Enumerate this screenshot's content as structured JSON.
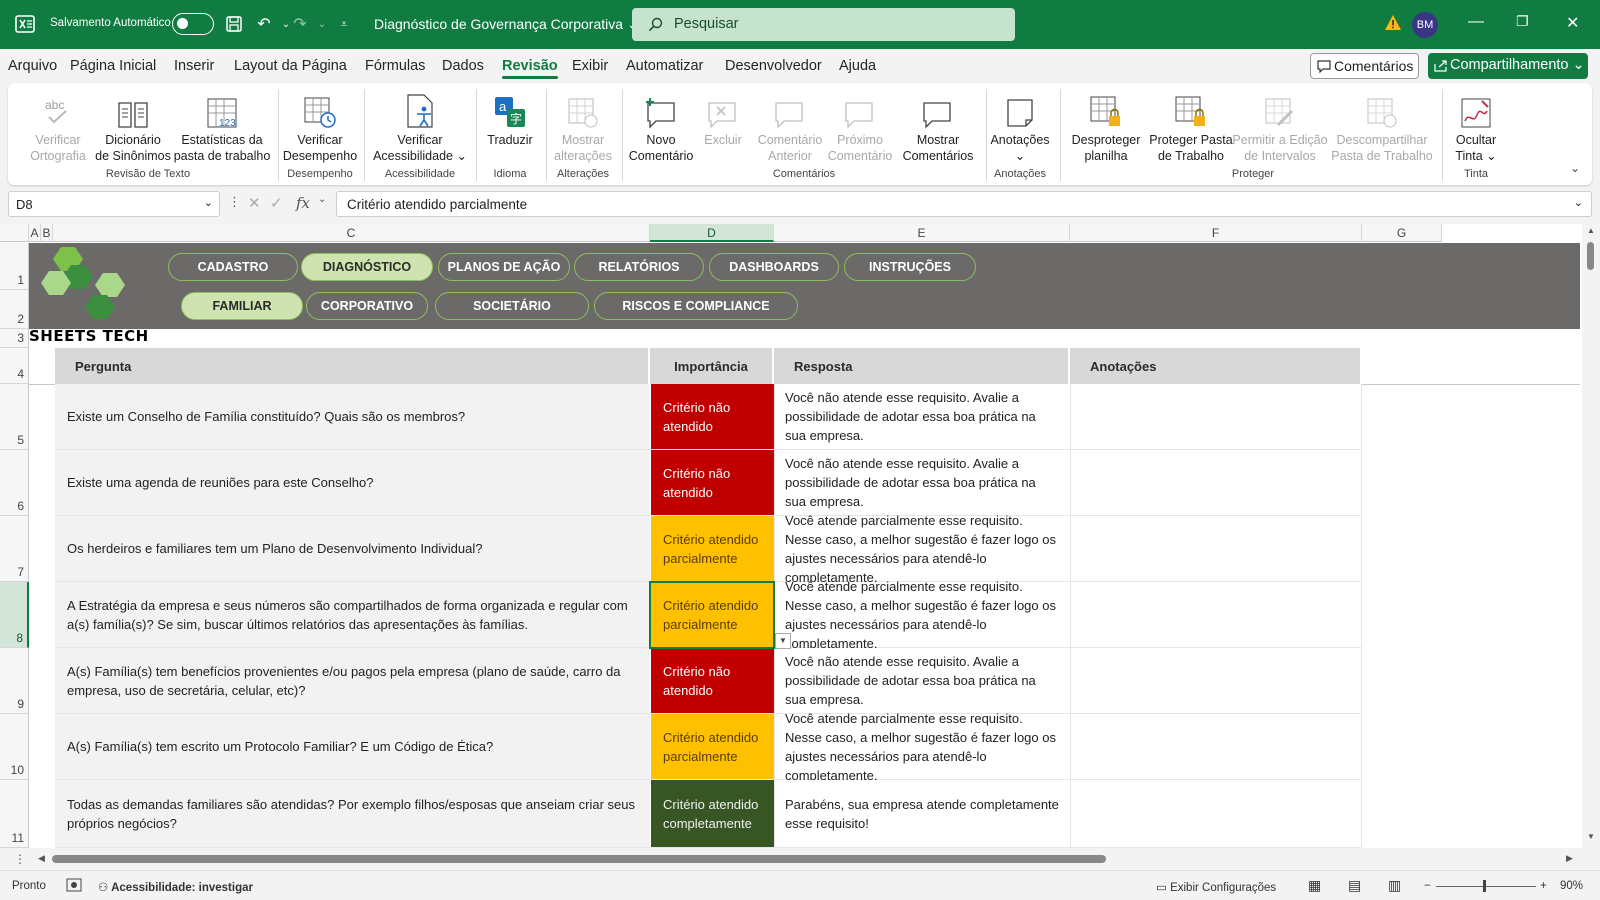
{
  "app": {
    "autosave_label": "Salvamento Automático",
    "doc_title": "Diagnóstico de Governança Corporativa",
    "search_placeholder": "Pesquisar",
    "avatar_initials": "BM",
    "accent": "#107c41"
  },
  "menu": {
    "tabs": [
      "Arquivo",
      "Página Inicial",
      "Inserir",
      "Layout da Página",
      "Fórmulas",
      "Dados",
      "Revisão",
      "Exibir",
      "Automatizar",
      "Desenvolvedor",
      "Ajuda"
    ],
    "active": "Revisão",
    "comments_btn": "Comentários",
    "share_btn": "Compartilhamento"
  },
  "ribbon": {
    "buttons": [
      {
        "l1": "Verificar",
        "l2": "Ortografia",
        "disabled": true,
        "icon": "abc-check-icon"
      },
      {
        "l1": "Dicionário",
        "l2": "de Sinônimos",
        "disabled": false,
        "icon": "thesaurus-book-icon"
      },
      {
        "l1": "Estatísticas da",
        "l2": "pasta de trabalho",
        "disabled": false,
        "icon": "workbook-statistics-icon"
      },
      {
        "l1": "Verificar",
        "l2": "Desempenho",
        "disabled": false,
        "icon": "performance-check-icon"
      },
      {
        "l1": "Verificar",
        "l2": "Acessibilidade ⌄",
        "disabled": false,
        "icon": "accessibility-icon"
      },
      {
        "l1": "Traduzir",
        "l2": "",
        "disabled": false,
        "icon": "translate-icon"
      },
      {
        "l1": "Mostrar",
        "l2": "alterações",
        "disabled": true,
        "icon": "show-changes-icon"
      },
      {
        "l1": "Novo",
        "l2": "Comentário",
        "disabled": false,
        "icon": "new-comment-icon"
      },
      {
        "l1": "Excluir",
        "l2": "",
        "disabled": true,
        "icon": "delete-comment-icon"
      },
      {
        "l1": "Comentário",
        "l2": "Anterior",
        "disabled": true,
        "icon": "previous-comment-icon"
      },
      {
        "l1": "Próximo",
        "l2": "Comentário",
        "disabled": true,
        "icon": "next-comment-icon"
      },
      {
        "l1": "Mostrar",
        "l2": "Comentários",
        "disabled": false,
        "icon": "show-comments-icon"
      },
      {
        "l1": "Anotações",
        "l2": "⌄",
        "disabled": false,
        "icon": "notes-icon"
      },
      {
        "l1": "Desproteger",
        "l2": "planilha",
        "disabled": false,
        "icon": "unprotect-sheet-icon"
      },
      {
        "l1": "Proteger Pasta",
        "l2": "de Trabalho",
        "disabled": false,
        "icon": "protect-workbook-icon"
      },
      {
        "l1": "Permitir a Edição",
        "l2": "de Intervalos",
        "disabled": true,
        "icon": "allow-edit-ranges-icon"
      },
      {
        "l1": "Descompartilhar",
        "l2": "Pasta de Trabalho",
        "disabled": true,
        "icon": "unshare-workbook-icon"
      },
      {
        "l1": "Ocultar",
        "l2": "Tinta ⌄",
        "disabled": false,
        "icon": "hide-ink-icon"
      }
    ],
    "groups": [
      "Revisão de Texto",
      "Desempenho",
      "Acessibilidade",
      "Idioma",
      "Alterações",
      "Comentários",
      "Anotações",
      "Proteger",
      "Tinta"
    ]
  },
  "formula_bar": {
    "cell_ref": "D8",
    "fx": "fx",
    "content": "Critério atendido parcialmente"
  },
  "columns": [
    "A",
    "B",
    "C",
    "D",
    "E",
    "F",
    "G"
  ],
  "rows": [
    "1",
    "2",
    "3",
    "4",
    "5",
    "6",
    "7",
    "8",
    "9",
    "10",
    "11"
  ],
  "nav": {
    "row1": [
      "CADASTRO",
      "DIAGNÓSTICO",
      "PLANOS DE AÇÃO",
      "RELATÓRIOS",
      "DASHBOARDS",
      "INSTRUÇÕES"
    ],
    "row2": [
      "FAMILIAR",
      "CORPORATIVO",
      "SOCIETÁRIO",
      "RISCOS E COMPLIANCE"
    ],
    "active1": "DIAGNÓSTICO",
    "active2": "FAMILIAR"
  },
  "brand": "SHEETS TECH",
  "logo_colors": [
    "#7ec14a",
    "#3c8f3e",
    "#a9d88a"
  ],
  "table": {
    "headers": [
      "Pergunta",
      "Importância",
      "Resposta",
      "Anotações"
    ],
    "rows": [
      {
        "q": "Existe um Conselho de Família constituído? Quais são os membros?",
        "imp": "Critério não atendido",
        "lvl": "red",
        "resp": "Você não atende esse requisito. Avalie a possibilidade de adotar essa boa prática na sua empresa.",
        "note": ""
      },
      {
        "q": "Existe uma agenda de reuniões para este Conselho?",
        "imp": "Critério não atendido",
        "lvl": "red",
        "resp": "Você não atende esse requisito. Avalie a possibilidade de adotar essa boa prática na sua empresa.",
        "note": ""
      },
      {
        "q": "Os herdeiros e familiares tem um Plano de Desenvolvimento Individual?",
        "imp": "Critério atendido parcialmente",
        "lvl": "yel",
        "resp": "Você atende parcialmente esse requisito. Nesse caso, a melhor sugestão é fazer logo os ajustes necessários para atendê-lo completamente.",
        "note": ""
      },
      {
        "q": "A Estratégia da empresa e seus números são compartilhados de forma organizada e regular com a(s) família(s)? Se sim, buscar últimos relatórios das apresentações às famílias.",
        "imp": "Critério atendido parcialmente",
        "lvl": "yel",
        "resp": "Você atende parcialmente esse requisito. Nesse caso, a melhor sugestão é fazer logo os ajustes necessários para atendê-lo completamente.",
        "note": ""
      },
      {
        "q": "A(s) Família(s) tem benefícios provenientes e/ou pagos pela empresa (plano de saúde, carro da empresa, uso de secretária, celular, etc)?",
        "imp": "Critério não atendido",
        "lvl": "red",
        "resp": "Você não atende esse requisito. Avalie a possibilidade de adotar essa boa prática na sua empresa.",
        "note": ""
      },
      {
        "q": "A(s) Família(s) tem escrito um Protocolo Familiar? E um Código de Ética?",
        "imp": "Critério atendido parcialmente",
        "lvl": "yel",
        "resp": "Você atende parcialmente esse requisito. Nesse caso, a melhor sugestão é fazer logo os ajustes necessários para atendê-lo completamente.",
        "note": ""
      },
      {
        "q": "Todas as demandas familiares são atendidas? Por exemplo filhos/esposas que anseiam criar seus próprios negócios?",
        "imp": "Critério atendido completamente",
        "lvl": "grn",
        "resp": "Parabéns, sua empresa atende completamente esse requisito!",
        "note": ""
      }
    ]
  },
  "status": {
    "ready": "Pronto",
    "accessibility": "Acessibilidade: investigar",
    "display_settings": "Exibir Configurações",
    "zoom": "90%"
  }
}
